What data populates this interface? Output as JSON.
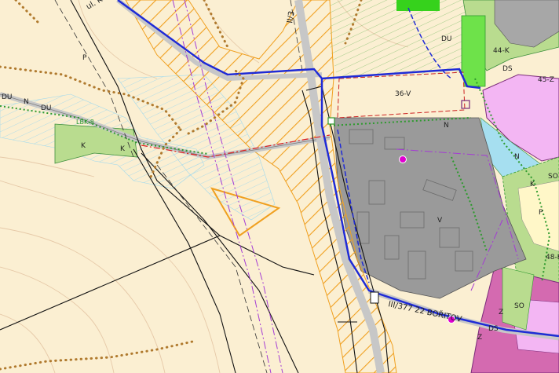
{
  "colors": {
    "background": "#fbefd2",
    "built_up_gray": "#9a9a9a",
    "green_zone": "#b9dc8f",
    "bright_green": "#36d21c",
    "pink_zone": "#f3b6f3",
    "magenta_zone": "#d46ab0",
    "light_blue": "#a6dff0",
    "orange_hatch": "#f0a020",
    "dotted_brown": "#b07a2e",
    "boundary_blue": "#1f2bd6",
    "road_gray": "#c7c7c7"
  },
  "labels": {
    "du_1": "DU",
    "n_1": "N",
    "du_2": "DU",
    "lbk": "LBK 8",
    "k_1": "K",
    "k_2": "K",
    "p_1": "P",
    "road_top": "ul. KUNSTÁT",
    "road_vertical": "II/3",
    "du_top": "DU",
    "k44": "44-K",
    "ds_1": "DS",
    "z45": "45-Z",
    "v36": "36-V",
    "n_mid": "N",
    "v_mid": "V",
    "n_right": "N",
    "k_right": "K",
    "so_1": "SO",
    "p_right": "P",
    "k48": "48-K",
    "road_bottom": "III/377 22 BOŘITOV",
    "ds_2": "DS",
    "z_1": "Z",
    "so_2": "SO",
    "z_2": "Z"
  }
}
